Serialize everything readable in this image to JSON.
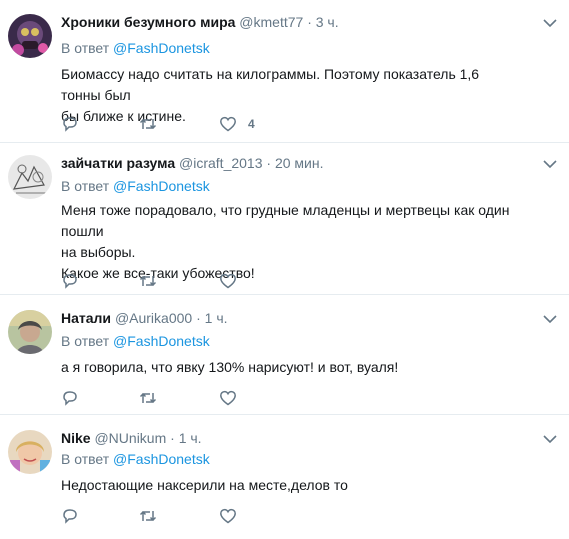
{
  "tweets": [
    {
      "name": "Хроники безумного мира",
      "handle": "@kmett77",
      "time": "· 3 ч.",
      "reply_prefix": "В ответ",
      "reply_to": "@FashDonetsk",
      "text": "Биомассу надо считать на килограммы. Поэтому показатель 1,6 тонны был\nбы ближе  к истине.",
      "likes": "4"
    },
    {
      "name": "зайчатки разума",
      "handle": "@icraft_2013",
      "time": "· 20 мин.",
      "reply_prefix": "В ответ",
      "reply_to": "@FashDonetsk",
      "text": "Меня тоже порадовало, что грудные младенцы и мертвецы как один пошли\nна выборы.\nКакое же все-таки убожество!",
      "likes": ""
    },
    {
      "name": "Натали",
      "handle": "@Aurika000",
      "time": "· 1 ч.",
      "reply_prefix": "В ответ",
      "reply_to": "@FashDonetsk",
      "text": "а я говорила, что явку 130% нарисуют! и вот, вуаля!",
      "likes": ""
    },
    {
      "name": "Nike",
      "handle": "@NUnikum",
      "time": "· 1 ч.",
      "reply_prefix": "В ответ",
      "reply_to": "@FashDonetsk",
      "text": "Недостающие наксерили на месте,делов то",
      "likes": ""
    }
  ],
  "colors": {
    "link": "#1b95e0",
    "meta": "#657786",
    "divider": "#e6ecf0"
  },
  "icons": [
    "reply-icon",
    "retweet-icon",
    "like-icon",
    "chevron-down-icon"
  ]
}
